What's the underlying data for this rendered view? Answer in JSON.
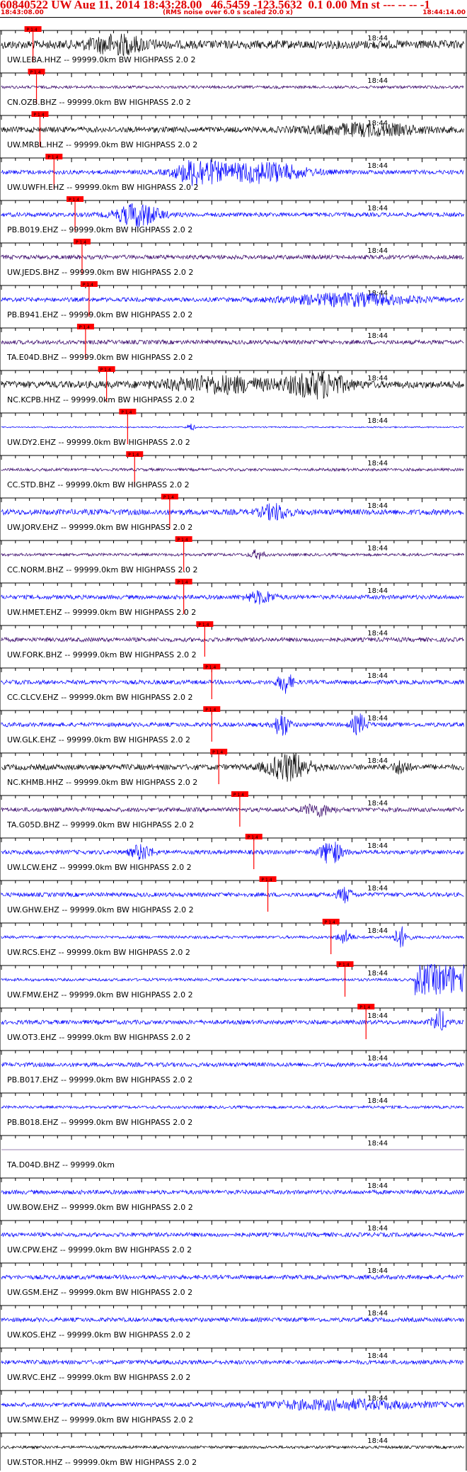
{
  "header": {
    "title": "60840522 UW Aug 11, 2014 18:43:28.00   46.5459 -123.5632  0.1 0.00 Mn st --- -- -- -1",
    "start_time": "18:43:08.00",
    "end_time": "18:44:14.00",
    "note": "(RMS noise over 6.0 s scaled 20.0 x)"
  },
  "colors": {
    "pick_red": "#ff0000",
    "blue": "#0000ff",
    "black": "#000000",
    "purple": "#330066"
  },
  "chart_data": {
    "type": "line",
    "title": "60840522 UW Aug 11, 2014 18:43:28.00   46.5459 -123.5632  0.1 0.00 Mn st --- -- -- -1",
    "xlim": [
      "18:43:08.00",
      "18:44:14.00"
    ],
    "tick_label": "18:44",
    "pick_label": "P 1.4",
    "traces": [
      {
        "label": "UW.LEBA.HHZ -- 99999.0km BW  HIGHPASS  2.0  2",
        "color": "#000000",
        "pick": "18:43:12.5",
        "amp": 6,
        "bursts": [
          {
            "t": 16.5,
            "a": 11,
            "w": 4
          }
        ]
      },
      {
        "label": "CN.OZB.BHZ -- 99999.0km BW  HIGHPASS  2.0  2",
        "color": "#330066",
        "pick": "18:43:13.0",
        "amp": 2,
        "bursts": []
      },
      {
        "label": "UW.MRBL.HHZ -- 99999.0km BW  HIGHPASS  2.0  2",
        "color": "#000000",
        "pick": "18:43:13.5",
        "amp": 4,
        "bursts": [
          {
            "t": 52,
            "a": 7,
            "w": 8
          }
        ]
      },
      {
        "label": "UW.UWFH.EHZ -- 99999.0km BW  HIGHPASS  2.0  2",
        "color": "#0000ff",
        "pick": "18:43:15.5",
        "amp": 3,
        "bursts": [
          {
            "t": 28,
            "a": 18,
            "w": 3
          },
          {
            "t": 37,
            "a": 14,
            "w": 6
          }
        ]
      },
      {
        "label": "PB.B019.EHZ -- 99999.0km BW  HIGHPASS  2.0  2",
        "color": "#0000ff",
        "pick": "18:43:18.5",
        "amp": 3,
        "bursts": [
          {
            "t": 19.5,
            "a": 16,
            "w": 3
          }
        ]
      },
      {
        "label": "UW.JEDS.BHZ -- 99999.0km BW  HIGHPASS  2.0  2",
        "color": "#330066",
        "pick": "18:43:19.5",
        "amp": 3,
        "bursts": []
      },
      {
        "label": "PB.B941.EHZ -- 99999.0km BW  HIGHPASS  2.0  2",
        "color": "#0000ff",
        "pick": "18:43:20.5",
        "amp": 3,
        "bursts": [
          {
            "t": 50,
            "a": 8,
            "w": 9
          }
        ]
      },
      {
        "label": "TA.E04D.BHZ -- 99999.0km BW  HIGHPASS  2.0  2",
        "color": "#330066",
        "pick": "18:43:20.0",
        "amp": 3,
        "bursts": []
      },
      {
        "label": "NC.KCPB.HHZ -- 99999.0km BW  HIGHPASS  2.0  2",
        "color": "#000000",
        "pick": "18:43:23.0",
        "amp": 5,
        "bursts": [
          {
            "t": 31,
            "a": 10,
            "w": 7
          },
          {
            "t": 45,
            "a": 17,
            "w": 4
          }
        ]
      },
      {
        "label": "UW.DY2.EHZ -- 99999.0km BW  HIGHPASS  2.0  2",
        "color": "#0000ff",
        "pick": "18:43:26.0",
        "amp": 1,
        "bursts": [
          {
            "t": 27,
            "a": 6,
            "w": 0.5
          }
        ]
      },
      {
        "label": "CC.STD.BHZ -- 99999.0km BW  HIGHPASS  2.0  2",
        "color": "#330066",
        "pick": "18:43:27.0",
        "amp": 2,
        "bursts": []
      },
      {
        "label": "UW.JORV.EHZ -- 99999.0km BW  HIGHPASS  2.0  2",
        "color": "#0000ff",
        "pick": "18:43:32.0",
        "amp": 4,
        "bursts": [
          {
            "t": 39,
            "a": 10,
            "w": 2
          }
        ]
      },
      {
        "label": "CC.NORM.BHZ -- 99999.0km BW  HIGHPASS  2.0  2",
        "color": "#330066",
        "pick": "18:43:34.0",
        "amp": 2,
        "bursts": [
          {
            "t": 36.5,
            "a": 6,
            "w": 1
          }
        ]
      },
      {
        "label": "UW.HMET.EHZ -- 99999.0km BW  HIGHPASS  2.0  2",
        "color": "#0000ff",
        "pick": "18:43:34.0",
        "amp": 3,
        "bursts": [
          {
            "t": 37,
            "a": 8,
            "w": 2
          }
        ]
      },
      {
        "label": "UW.FORK.BHZ -- 99999.0km BW  HIGHPASS  2.0  2",
        "color": "#330066",
        "pick": "18:43:37.0",
        "amp": 3,
        "bursts": []
      },
      {
        "label": "CC.CLCV.EHZ -- 99999.0km BW  HIGHPASS  2.0  2",
        "color": "#0000ff",
        "pick": "18:43:38.0",
        "amp": 3,
        "bursts": [
          {
            "t": 40.5,
            "a": 14,
            "w": 1
          }
        ]
      },
      {
        "label": "UW.GLK.EHZ -- 99999.0km BW  HIGHPASS  2.0  2",
        "color": "#0000ff",
        "pick": "18:43:38.0",
        "amp": 3,
        "bursts": [
          {
            "t": 40,
            "a": 17,
            "w": 1
          },
          {
            "t": 51,
            "a": 14,
            "w": 1
          }
        ]
      },
      {
        "label": "NC.KHMB.HHZ -- 99999.0km BW  HIGHPASS  2.0  2",
        "color": "#000000",
        "pick": "18:43:39.0",
        "amp": 4,
        "bursts": [
          {
            "t": 41,
            "a": 18,
            "w": 3
          },
          {
            "t": 57,
            "a": 9,
            "w": 1
          }
        ]
      },
      {
        "label": "TA.G05D.BHZ -- 99999.0km BW  HIGHPASS  2.0  2",
        "color": "#330066",
        "pick": "18:43:42.0",
        "amp": 3,
        "bursts": [
          {
            "t": 45,
            "a": 8,
            "w": 2
          }
        ]
      },
      {
        "label": "UW.LCW.EHZ -- 99999.0km BW  HIGHPASS  2.0  2",
        "color": "#0000ff",
        "pick": "18:43:44.0",
        "amp": 3,
        "bursts": [
          {
            "t": 47,
            "a": 16,
            "w": 1.5
          },
          {
            "t": 20,
            "a": 10,
            "w": 1.5
          }
        ]
      },
      {
        "label": "UW.GHW.EHZ -- 99999.0km BW  HIGHPASS  2.0  2",
        "color": "#0000ff",
        "pick": "18:43:46.0",
        "amp": 3,
        "bursts": [
          {
            "t": 49,
            "a": 10,
            "w": 1
          }
        ]
      },
      {
        "label": "UW.RCS.EHZ -- 99999.0km BW  HIGHPASS  2.0  2",
        "color": "#0000ff",
        "pick": "18:43:55.0",
        "amp": 2,
        "bursts": [
          {
            "t": 57,
            "a": 14,
            "w": 1
          },
          {
            "t": 49,
            "a": 9,
            "w": 1
          }
        ]
      },
      {
        "label": "UW.FMW.EHZ -- 99999.0km BW  HIGHPASS  2.0  2",
        "color": "#0000ff",
        "pick": "18:43:57.0",
        "amp": 2,
        "bursts": [],
        "clip": 59
      },
      {
        "label": "UW.OT3.EHZ -- 99999.0km BW  HIGHPASS  2.0  2",
        "color": "#0000ff",
        "pick": "18:44:00.0",
        "amp": 3,
        "bursts": [
          {
            "t": 62.5,
            "a": 16,
            "w": 1
          }
        ]
      },
      {
        "label": "PB.B017.EHZ -- 99999.0km BW  HIGHPASS  2.0  2",
        "color": "#0000ff",
        "pick": null,
        "amp": 3,
        "bursts": []
      },
      {
        "label": "PB.B018.EHZ -- 99999.0km BW  HIGHPASS  2.0  2",
        "color": "#0000ff",
        "pick": null,
        "amp": 2,
        "bursts": []
      },
      {
        "label": "TA.D04D.BHZ -- 99999.0km",
        "color": "#330066",
        "pick": null,
        "amp": 0,
        "bursts": []
      },
      {
        "label": "UW.BOW.EHZ -- 99999.0km BW  HIGHPASS  2.0  2",
        "color": "#0000ff",
        "pick": null,
        "amp": 3,
        "bursts": []
      },
      {
        "label": "UW.CPW.EHZ -- 99999.0km BW  HIGHPASS  2.0  2",
        "color": "#0000ff",
        "pick": null,
        "amp": 3,
        "bursts": []
      },
      {
        "label": "UW.GSM.EHZ -- 99999.0km BW  HIGHPASS  2.0  2",
        "color": "#0000ff",
        "pick": null,
        "amp": 3,
        "bursts": []
      },
      {
        "label": "UW.KOS.EHZ -- 99999.0km BW  HIGHPASS  2.0  2",
        "color": "#0000ff",
        "pick": null,
        "amp": 3,
        "bursts": []
      },
      {
        "label": "UW.RVC.EHZ -- 99999.0km BW  HIGHPASS  2.0  2",
        "color": "#0000ff",
        "pick": null,
        "amp": 3,
        "bursts": []
      },
      {
        "label": "UW.SMW.EHZ -- 99999.0km BW  HIGHPASS  2.0  2",
        "color": "#0000ff",
        "pick": null,
        "amp": 3,
        "bursts": [
          {
            "t": 48,
            "a": 6,
            "w": 12
          }
        ]
      },
      {
        "label": "UW.STOR.HHZ -- 99999.0km BW  HIGHPASS  2.0  2",
        "color": "#000000",
        "pick": null,
        "amp": 2,
        "bursts": []
      }
    ]
  }
}
